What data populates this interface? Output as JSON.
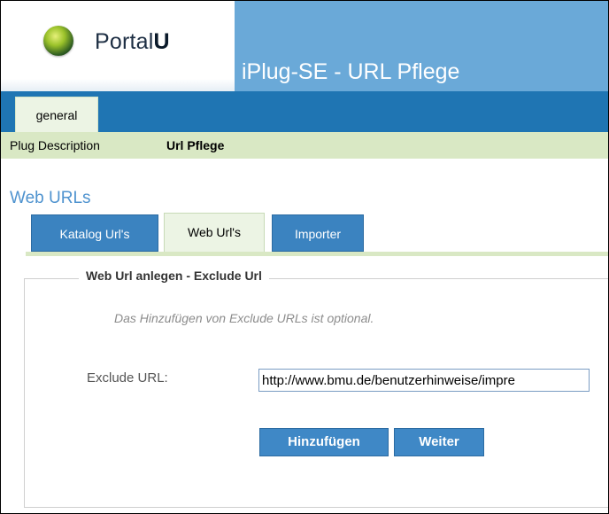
{
  "header": {
    "logo_text_light": "Portal",
    "logo_text_bold": "U",
    "app_title": "iPlug-SE - URL Pflege"
  },
  "main_nav": {
    "tabs": [
      {
        "label": "general",
        "active": true
      }
    ]
  },
  "sub_nav": {
    "items": [
      {
        "label": "Plug Description",
        "active": false
      },
      {
        "label": "Url Pflege",
        "active": true
      }
    ]
  },
  "section": {
    "title": "Web URLs",
    "tabs": [
      {
        "label": "Katalog Url's",
        "active": false
      },
      {
        "label": "Web Url's",
        "active": true
      },
      {
        "label": "Importer",
        "active": false
      }
    ]
  },
  "form": {
    "legend": "Web Url anlegen - Exclude Url",
    "hint": "Das Hinzufügen von Exclude URLs ist optional.",
    "exclude_url_label": "Exclude URL:",
    "exclude_url_value": "http://www.bmu.de/benutzerhinweise/impre",
    "add_button": "Hinzufügen",
    "next_button": "Weiter"
  },
  "colors": {
    "header_blue": "#6aa9d8",
    "tabbar_blue": "#1f75b3",
    "subnav_green": "#d9e8c4",
    "button_blue": "#3f88c6",
    "section_title_blue": "#4f93cf"
  }
}
